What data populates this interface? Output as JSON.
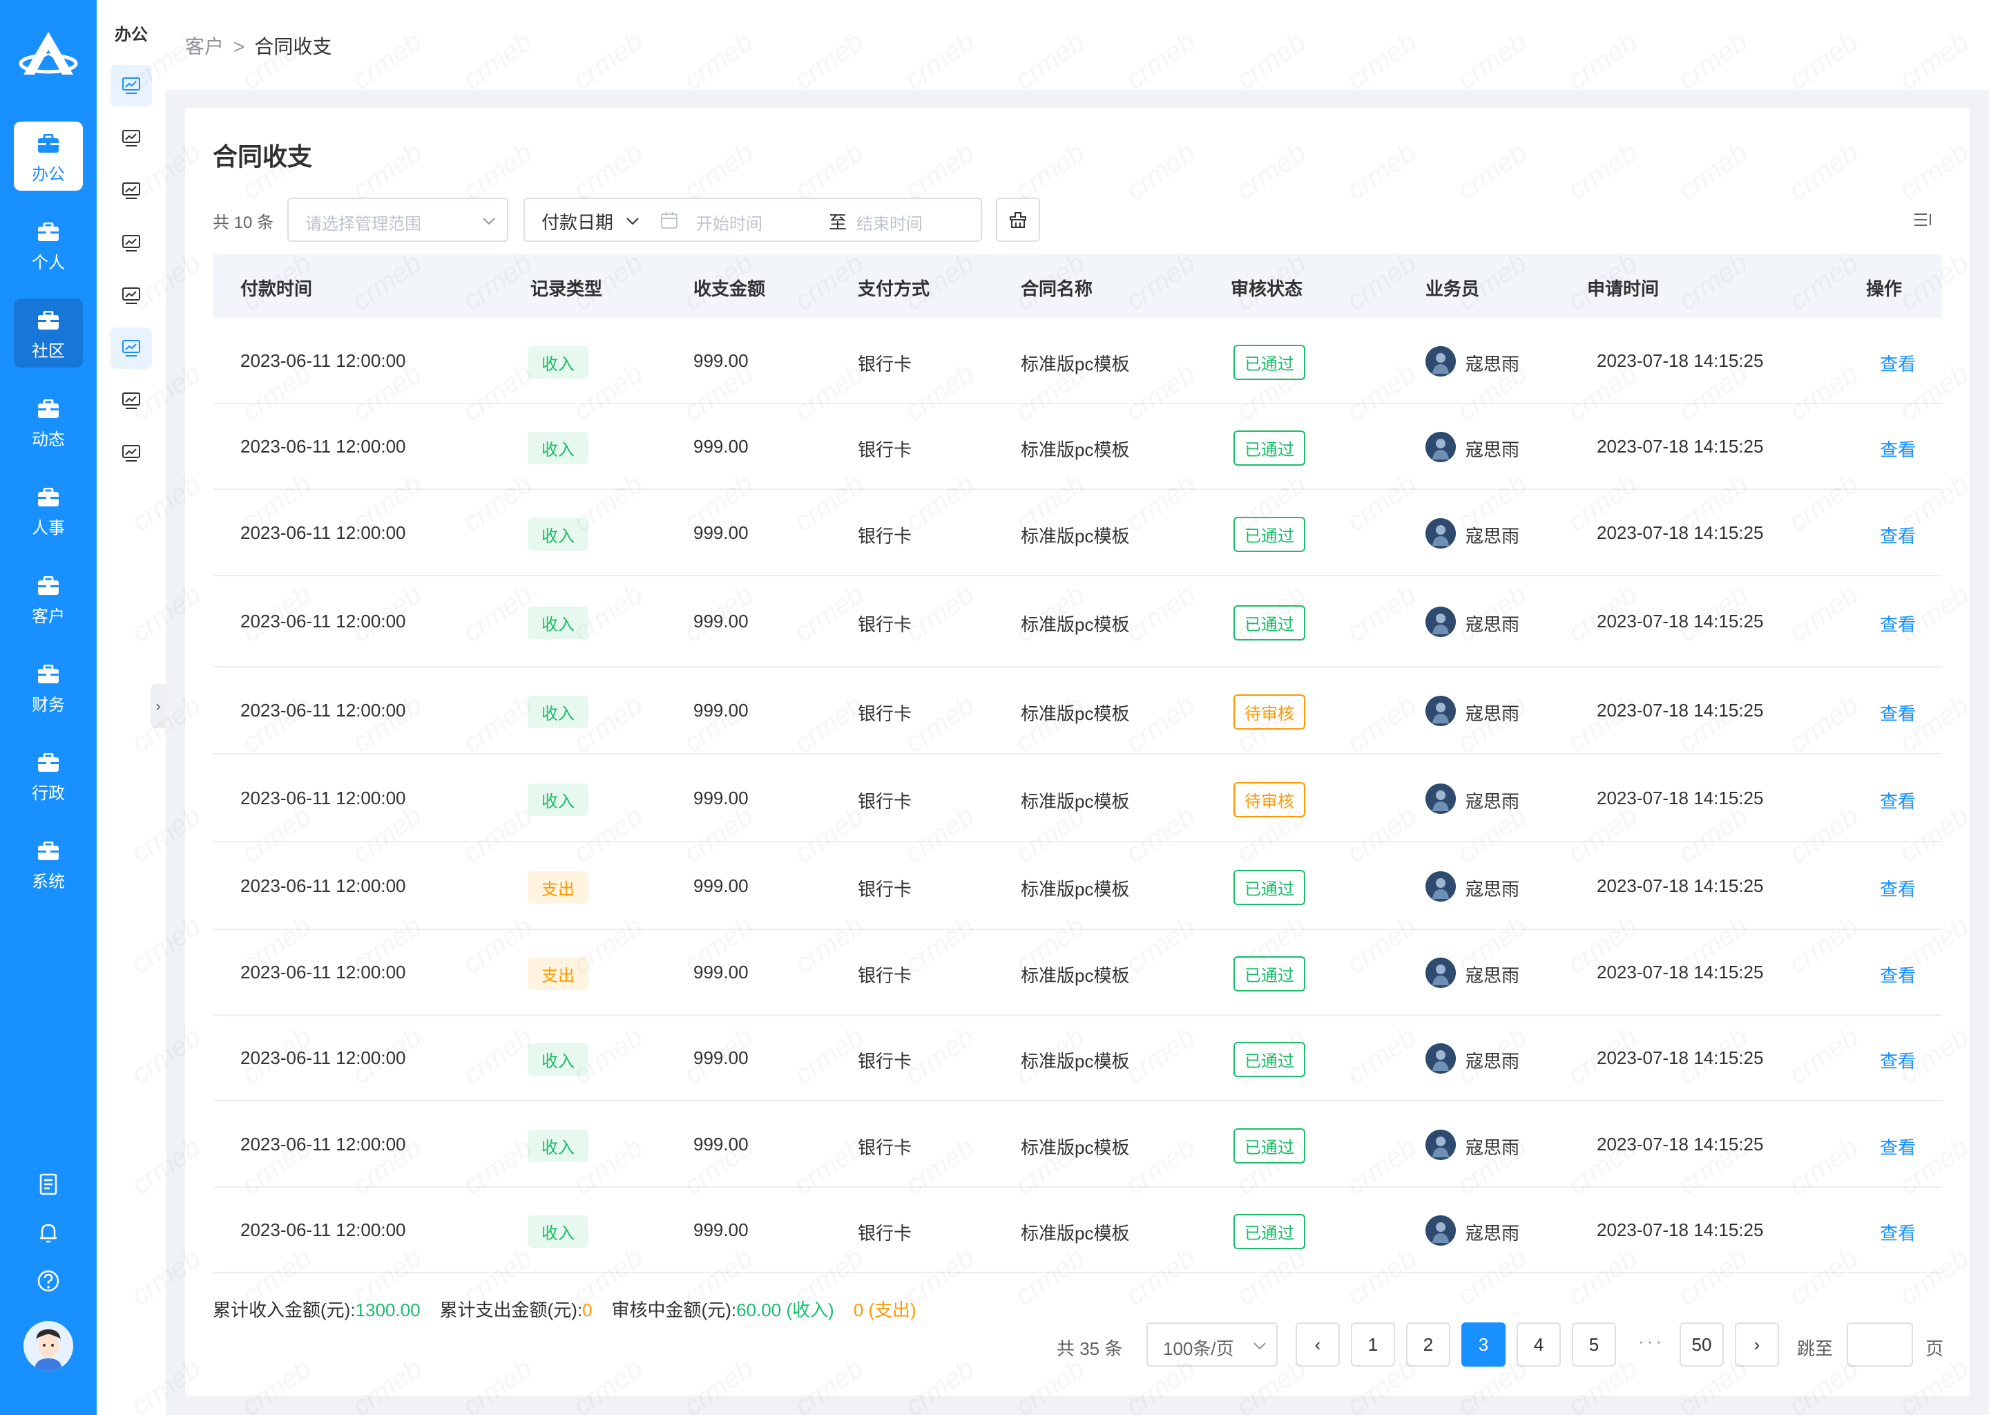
{
  "nav": {
    "items": [
      {
        "label": "办公",
        "icon": "briefcase-icon",
        "active": true
      },
      {
        "label": "个人",
        "icon": "briefcase-icon"
      },
      {
        "label": "社区",
        "icon": "briefcase-icon",
        "hover": true
      },
      {
        "label": "动态",
        "icon": "briefcase-icon"
      },
      {
        "label": "人事",
        "icon": "briefcase-icon"
      },
      {
        "label": "客户",
        "icon": "briefcase-icon"
      },
      {
        "label": "财务",
        "icon": "briefcase-icon"
      },
      {
        "label": "行政",
        "icon": "briefcase-icon"
      },
      {
        "label": "系统",
        "icon": "briefcase-icon"
      }
    ]
  },
  "subnav": {
    "title": "办公",
    "item_icon": "chart-monitor-icon",
    "active_indexes": [
      0,
      5
    ]
  },
  "collapse_glyph": "›",
  "breadcrumb": {
    "parent": "客户",
    "separator": ">",
    "current": "合同收支"
  },
  "page": {
    "title": "合同收支"
  },
  "filters": {
    "count_text": "共 10 条",
    "scope_placeholder": "请选择管理范围",
    "date_type": "付款日期",
    "start_placeholder": "开始时间",
    "to_label": "至",
    "end_placeholder": "结束时间"
  },
  "table": {
    "columns": [
      "付款时间",
      "记录类型",
      "收支金额",
      "支付方式",
      "合同名称",
      "审核状态",
      "业务员",
      "申请时间",
      "操作"
    ],
    "rows": [
      {
        "pay_time": "2023-06-11 12:00:00",
        "type": "收入",
        "type_kind": "in",
        "amount": "999.00",
        "method": "银行卡",
        "contract": "标准版pc模板",
        "status": "已通过",
        "status_kind": "pass",
        "salesman": "寇思雨",
        "apply_time": "2023-07-18 14:15:25",
        "action": "查看"
      },
      {
        "pay_time": "2023-06-11 12:00:00",
        "type": "收入",
        "type_kind": "in",
        "amount": "999.00",
        "method": "银行卡",
        "contract": "标准版pc模板",
        "status": "已通过",
        "status_kind": "pass",
        "salesman": "寇思雨",
        "apply_time": "2023-07-18 14:15:25",
        "action": "查看"
      },
      {
        "pay_time": "2023-06-11 12:00:00",
        "type": "收入",
        "type_kind": "in",
        "amount": "999.00",
        "method": "银行卡",
        "contract": "标准版pc模板",
        "status": "已通过",
        "status_kind": "pass",
        "salesman": "寇思雨",
        "apply_time": "2023-07-18 14:15:25",
        "action": "查看"
      },
      {
        "pay_time": "2023-06-11 12:00:00",
        "type": "收入",
        "type_kind": "in",
        "amount": "999.00",
        "method": "银行卡",
        "contract": "标准版pc模板",
        "status": "已通过",
        "status_kind": "pass",
        "salesman": "寇思雨",
        "apply_time": "2023-07-18 14:15:25",
        "action": "查看"
      },
      {
        "pay_time": "2023-06-11 12:00:00",
        "type": "收入",
        "type_kind": "in",
        "amount": "999.00",
        "method": "银行卡",
        "contract": "标准版pc模板",
        "status": "待审核",
        "status_kind": "wait",
        "salesman": "寇思雨",
        "apply_time": "2023-07-18 14:15:25",
        "action": "查看"
      },
      {
        "pay_time": "2023-06-11 12:00:00",
        "type": "收入",
        "type_kind": "in",
        "amount": "999.00",
        "method": "银行卡",
        "contract": "标准版pc模板",
        "status": "待审核",
        "status_kind": "wait",
        "salesman": "寇思雨",
        "apply_time": "2023-07-18 14:15:25",
        "action": "查看"
      },
      {
        "pay_time": "2023-06-11 12:00:00",
        "type": "支出",
        "type_kind": "out",
        "amount": "999.00",
        "method": "银行卡",
        "contract": "标准版pc模板",
        "status": "已通过",
        "status_kind": "pass",
        "salesman": "寇思雨",
        "apply_time": "2023-07-18 14:15:25",
        "action": "查看"
      },
      {
        "pay_time": "2023-06-11 12:00:00",
        "type": "支出",
        "type_kind": "out",
        "amount": "999.00",
        "method": "银行卡",
        "contract": "标准版pc模板",
        "status": "已通过",
        "status_kind": "pass",
        "salesman": "寇思雨",
        "apply_time": "2023-07-18 14:15:25",
        "action": "查看"
      },
      {
        "pay_time": "2023-06-11 12:00:00",
        "type": "收入",
        "type_kind": "in",
        "amount": "999.00",
        "method": "银行卡",
        "contract": "标准版pc模板",
        "status": "已通过",
        "status_kind": "pass",
        "salesman": "寇思雨",
        "apply_time": "2023-07-18 14:15:25",
        "action": "查看"
      },
      {
        "pay_time": "2023-06-11 12:00:00",
        "type": "收入",
        "type_kind": "in",
        "amount": "999.00",
        "method": "银行卡",
        "contract": "标准版pc模板",
        "status": "已通过",
        "status_kind": "pass",
        "salesman": "寇思雨",
        "apply_time": "2023-07-18 14:15:25",
        "action": "查看"
      },
      {
        "pay_time": "2023-06-11 12:00:00",
        "type": "收入",
        "type_kind": "in",
        "amount": "999.00",
        "method": "银行卡",
        "contract": "标准版pc模板",
        "status": "已通过",
        "status_kind": "pass",
        "salesman": "寇思雨",
        "apply_time": "2023-07-18 14:15:25",
        "action": "查看"
      }
    ]
  },
  "summary": {
    "income_label": "累计收入金额(元):",
    "income_value": "1300.00",
    "expense_label": "累计支出金额(元):",
    "expense_value": "0",
    "pending_label": "审核中金额(元):",
    "pending_income": "60.00 (收入)",
    "pending_expense": "0 (支出)"
  },
  "pagination": {
    "total_text": "共 35 条",
    "page_size": "100条/页",
    "prev": "‹",
    "next": "›",
    "pages": [
      "1",
      "2",
      "3",
      "4",
      "5"
    ],
    "current": "3",
    "ellipsis": "···",
    "last": "50",
    "jump_label": "跳至",
    "page_suffix": "页"
  },
  "watermark": "crmeb",
  "colors": {
    "primary": "#1890ff",
    "success": "#19be6b",
    "warning": "#ff9900"
  }
}
